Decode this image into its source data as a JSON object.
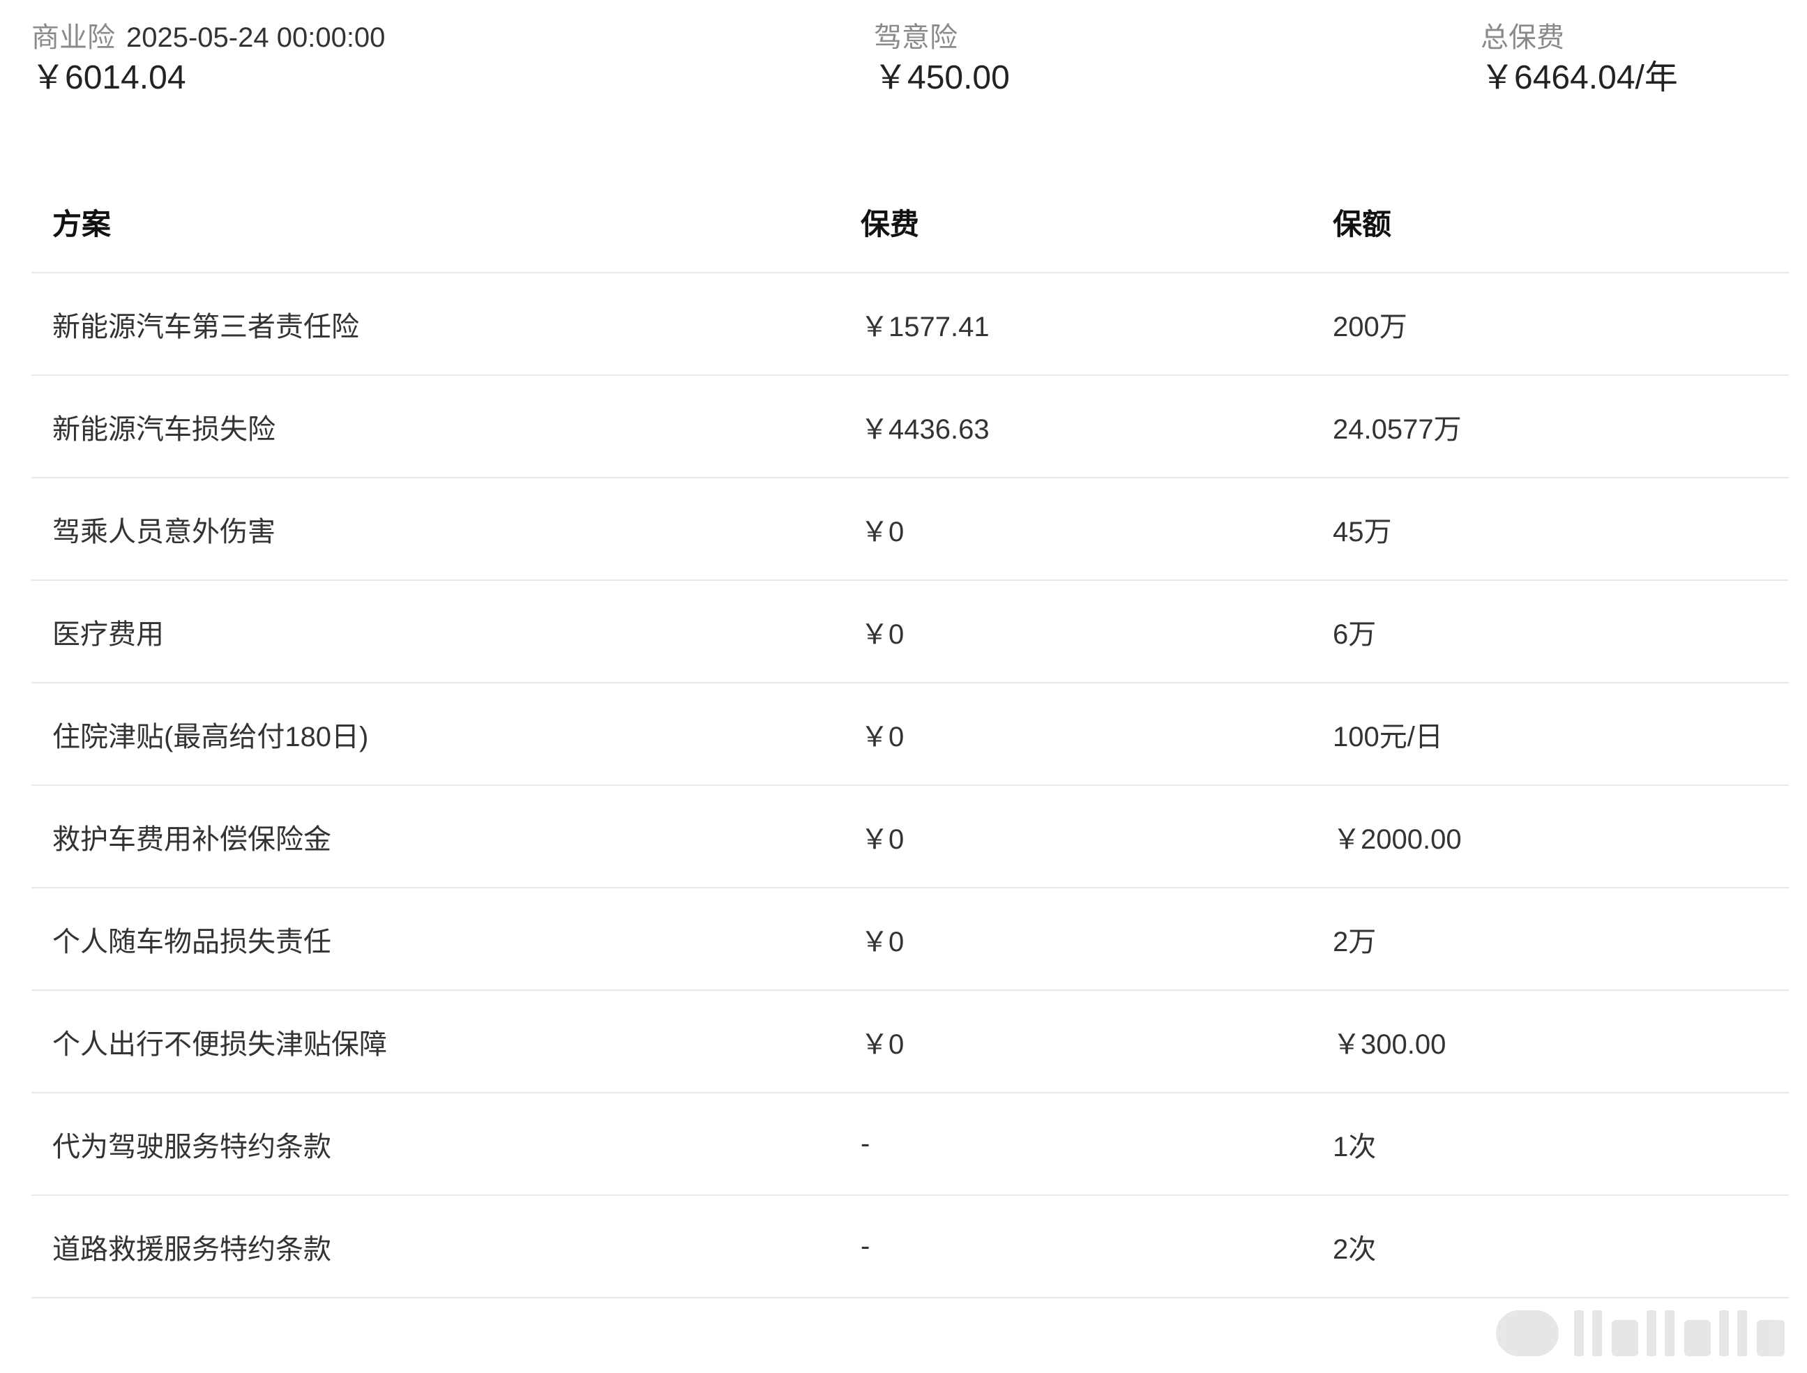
{
  "summary": {
    "commercial": {
      "label": "商业险",
      "date": "2025-05-24 00:00:00",
      "value": "￥6014.04"
    },
    "accident": {
      "label": "驾意险",
      "value": "￥450.00"
    },
    "total": {
      "label": "总保费",
      "value": "￥6464.04/年"
    }
  },
  "table": {
    "headers": {
      "plan": "方案",
      "premium": "保费",
      "coverage": "保额"
    },
    "rows": [
      {
        "plan": "新能源汽车第三者责任险",
        "premium": "￥1577.41",
        "coverage": "200万"
      },
      {
        "plan": "新能源汽车损失险",
        "premium": "￥4436.63",
        "coverage": "24.0577万"
      },
      {
        "plan": "驾乘人员意外伤害",
        "premium": "￥0",
        "coverage": "45万"
      },
      {
        "plan": "医疗费用",
        "premium": "￥0",
        "coverage": "6万"
      },
      {
        "plan": "住院津贴(最高给付180日)",
        "premium": "￥0",
        "coverage": "100元/日"
      },
      {
        "plan": "救护车费用补偿保险金",
        "premium": "￥0",
        "coverage": "￥2000.00"
      },
      {
        "plan": "个人随车物品损失责任",
        "premium": "￥0",
        "coverage": "2万"
      },
      {
        "plan": "个人出行不便损失津贴保障",
        "premium": "￥0",
        "coverage": "￥300.00"
      },
      {
        "plan": "代为驾驶服务特约条款",
        "premium": "-",
        "coverage": "1次"
      },
      {
        "plan": "道路救援服务特约条款",
        "premium": "-",
        "coverage": "2次"
      }
    ]
  },
  "colors": {
    "label": "#8a8a8a",
    "text": "#333333",
    "divider": "#e9e9e9"
  },
  "watermark_icon": "weibo-watermark-icon"
}
